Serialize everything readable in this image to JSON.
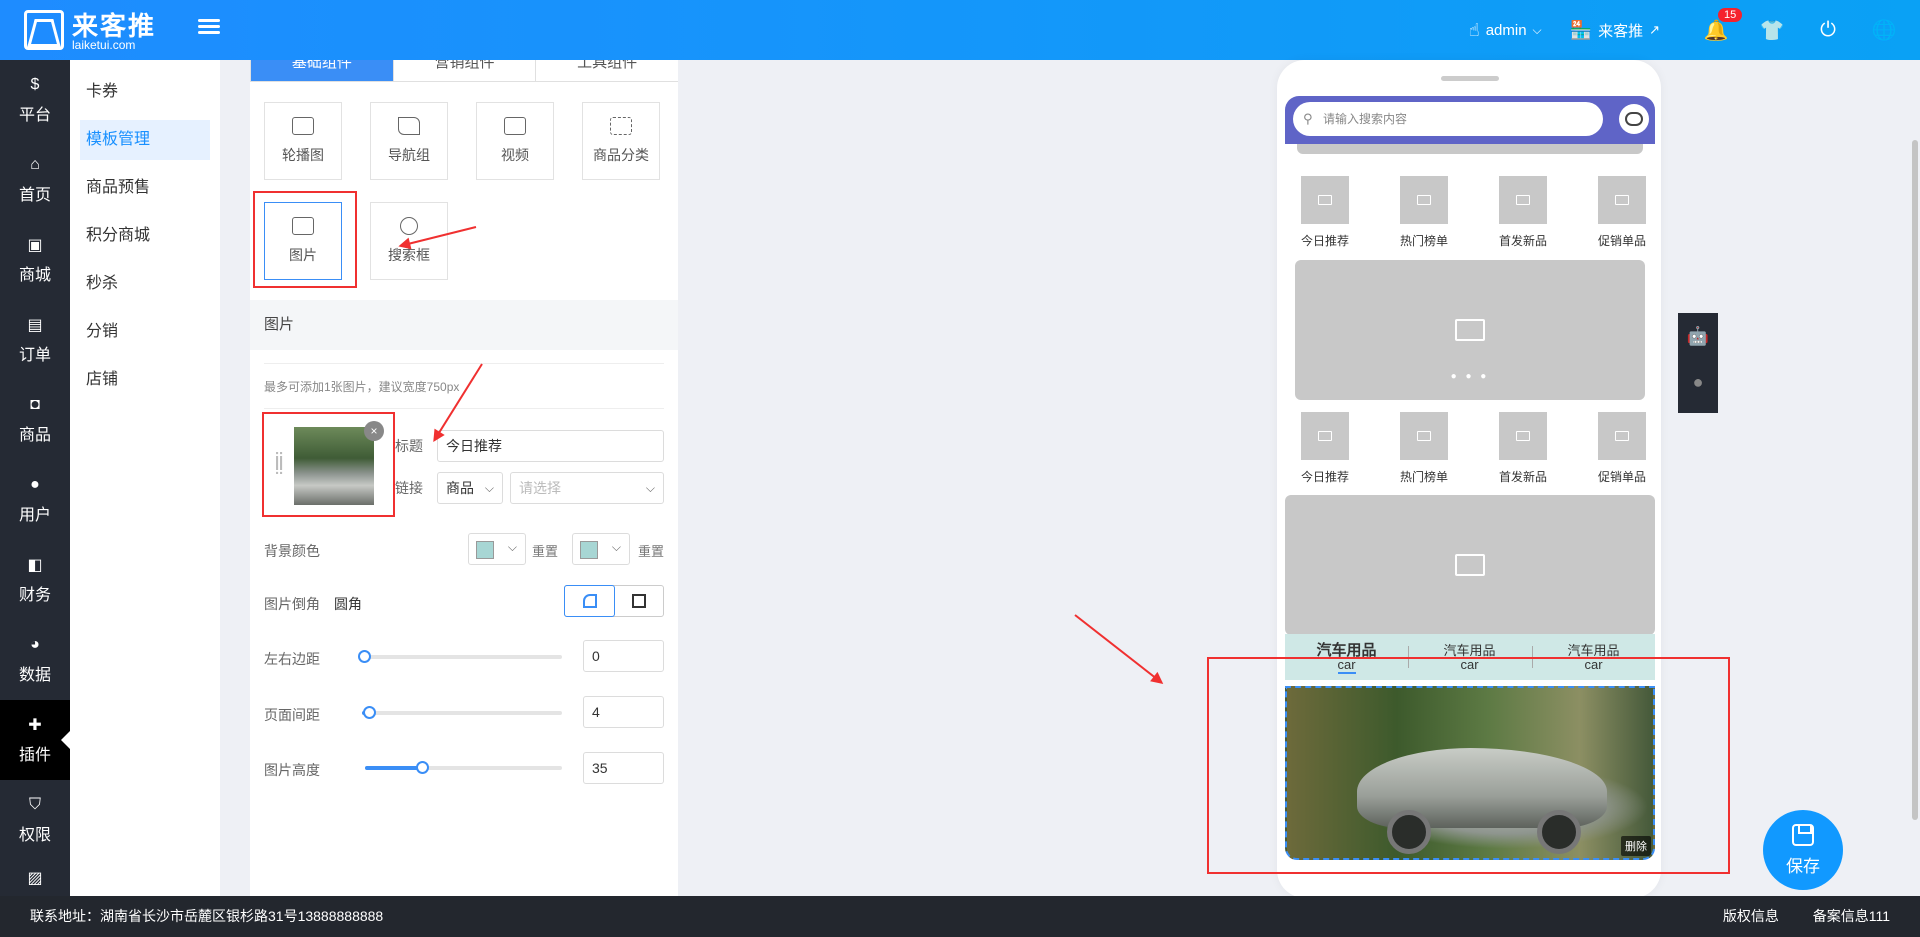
{
  "header": {
    "logo_title": "来客推",
    "logo_sub": "laiketui.com",
    "user": "admin",
    "store": "来客推",
    "notify_count": "15"
  },
  "nav": {
    "items": [
      {
        "label": "平台"
      },
      {
        "label": "首页"
      },
      {
        "label": "商城"
      },
      {
        "label": "订单"
      },
      {
        "label": "商品"
      },
      {
        "label": "用户"
      },
      {
        "label": "财务"
      },
      {
        "label": "数据"
      },
      {
        "label": "插件"
      },
      {
        "label": "权限"
      }
    ]
  },
  "subnav": {
    "items": [
      "卡券",
      "模板管理",
      "商品预售",
      "积分商城",
      "秒杀",
      "分销",
      "店铺"
    ]
  },
  "panel": {
    "tabs": [
      "基础组件",
      "营销组件",
      "工具组件"
    ],
    "components": [
      "轮播图",
      "导航组",
      "视频",
      "商品分类",
      "图片",
      "搜索框"
    ],
    "section_title": "图片",
    "hint": "最多可添加1张图片，建议宽度750px",
    "image_item": {
      "title_label": "标题",
      "title_value": "今日推荐",
      "link_label": "链接",
      "link_type": "商品",
      "link_placeholder": "请选择"
    },
    "bg_color_label": "背景颜色",
    "reset_label": "重置",
    "corner_label": "图片倒角",
    "corner_value": "圆角",
    "lr_margin_label": "左右边距",
    "lr_margin_value": "0",
    "page_gap_label": "页面间距",
    "page_gap_value": "4",
    "img_height_label": "图片高度",
    "img_height_value": "35"
  },
  "phone": {
    "search_placeholder": "请输入搜索内容",
    "nav_row": [
      "今日推荐",
      "热门榜单",
      "首发新品",
      "促销单品"
    ],
    "cat_tabs": [
      {
        "name": "汽车用品",
        "sub": "car"
      },
      {
        "name": "汽车用品",
        "sub": "car"
      },
      {
        "name": "汽车用品",
        "sub": "car"
      }
    ],
    "delete_label": "删除"
  },
  "save_label": "保存",
  "footer": {
    "address": "联系地址：湖南省长沙市岳麓区银杉路31号13888888888",
    "copyright": "版权信息",
    "icp": "备案信息111"
  },
  "colors": {
    "accent": "#3a8ef6",
    "header": "#1e8cff",
    "sidebar": "#252a34",
    "annotation": "#f03030"
  }
}
